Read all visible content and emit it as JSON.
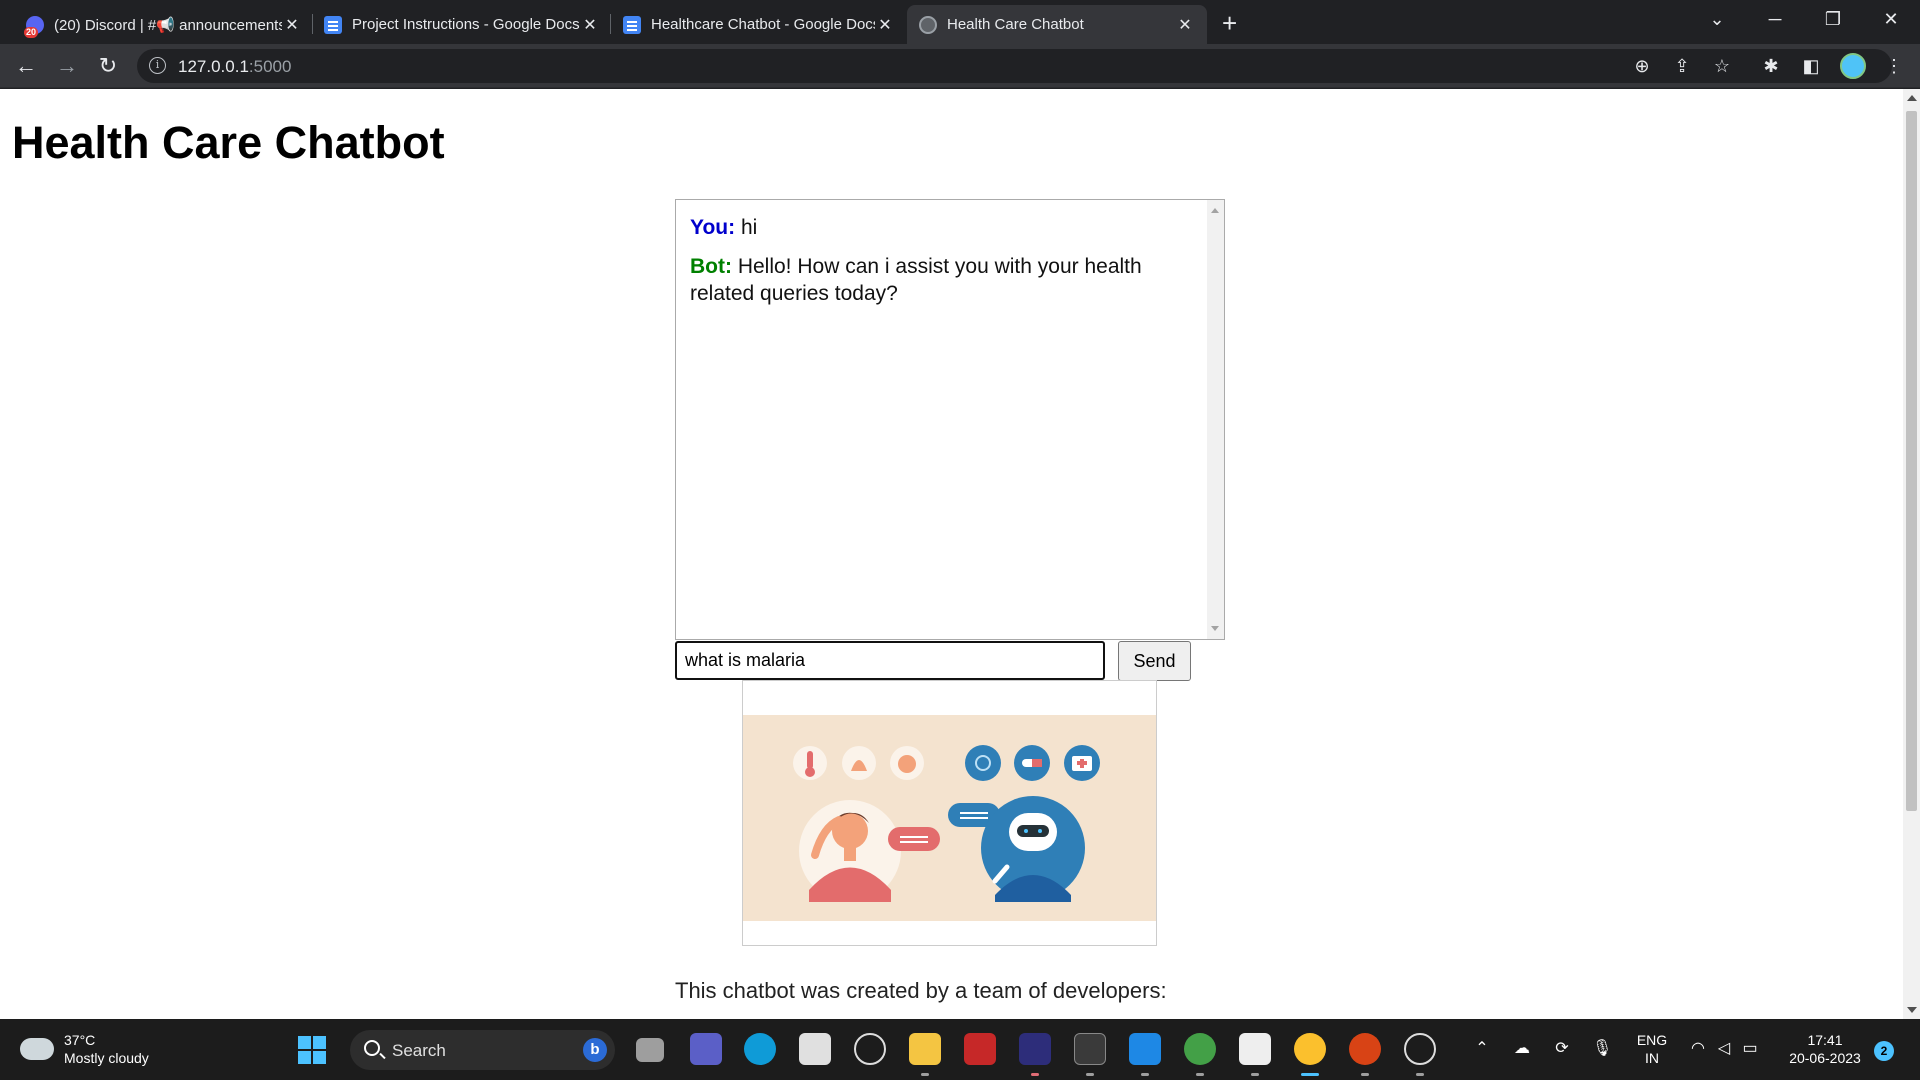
{
  "browser": {
    "tabs": [
      {
        "title": "(20) Discord | #📢 announcements",
        "badge": "20",
        "favicon": "discord-icon"
      },
      {
        "title": "Project Instructions - Google Docs",
        "favicon": "google-docs-icon"
      },
      {
        "title": "Healthcare Chatbot - Google Docs",
        "favicon": "google-docs-icon"
      },
      {
        "title": "Health Care Chatbot",
        "favicon": "globe-icon"
      }
    ],
    "url_host": "127.0.0.1",
    "url_port": ":5000"
  },
  "page": {
    "title": "Health Care Chatbot",
    "chat": {
      "messages": [
        {
          "sender": "You:",
          "text": "hi"
        },
        {
          "sender": "Bot:",
          "text": "Hello! How can i assist you with your health related queries today?"
        }
      ]
    },
    "input_value": "what is malaria",
    "send_label": "Send",
    "footer": "This chatbot was created by a team of developers:"
  },
  "taskbar": {
    "weather_temp": "37°C",
    "weather_desc": "Mostly cloudy",
    "search_label": "Search",
    "lang_top": "ENG",
    "lang_bottom": "IN",
    "time": "17:41",
    "date": "20-06-2023",
    "notification_count": "2"
  },
  "colors": {
    "you_label": "#0000cc",
    "bot_label": "#008000",
    "illustration_bg": "#f4e3cf",
    "accent": "#4cc2ff"
  }
}
